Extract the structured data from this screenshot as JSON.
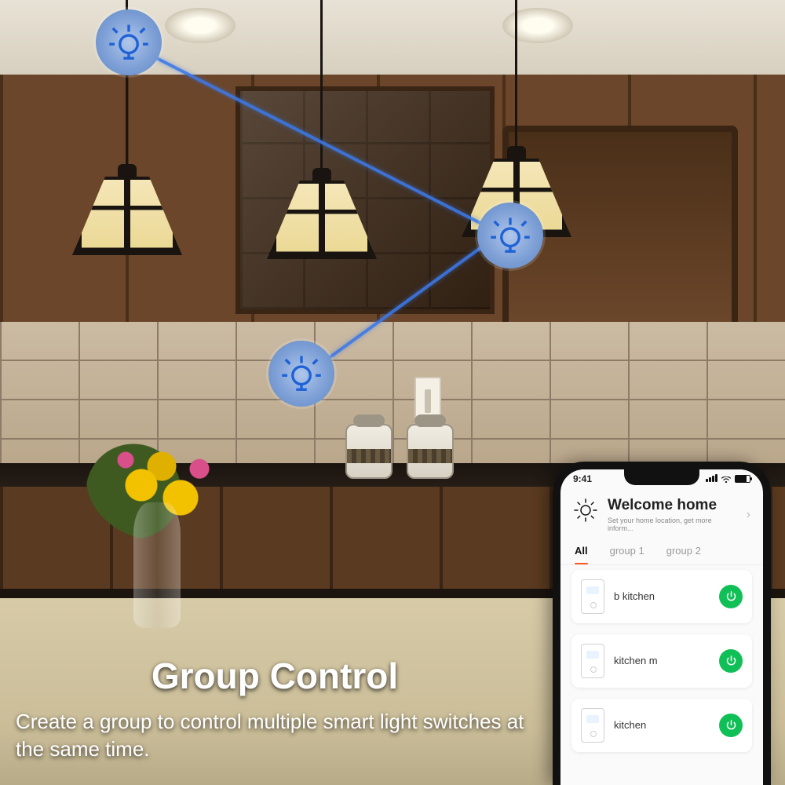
{
  "overlay": {
    "title": "Group Control",
    "subtitle": "Create a group to control multiple smart light switches at the same time."
  },
  "phone": {
    "status": {
      "time": "9:41"
    },
    "welcome": {
      "title": "Welcome home",
      "subtitle": "Set your home location, get more inform..."
    },
    "tabs": [
      "All",
      "group 1",
      "group 2"
    ],
    "active_tab": 0,
    "devices": [
      {
        "name": "b  kitchen"
      },
      {
        "name": "kitchen   m"
      },
      {
        "name": "kitchen"
      }
    ]
  },
  "colors": {
    "network_line": "#3b78e7",
    "power_on": "#10c057"
  }
}
